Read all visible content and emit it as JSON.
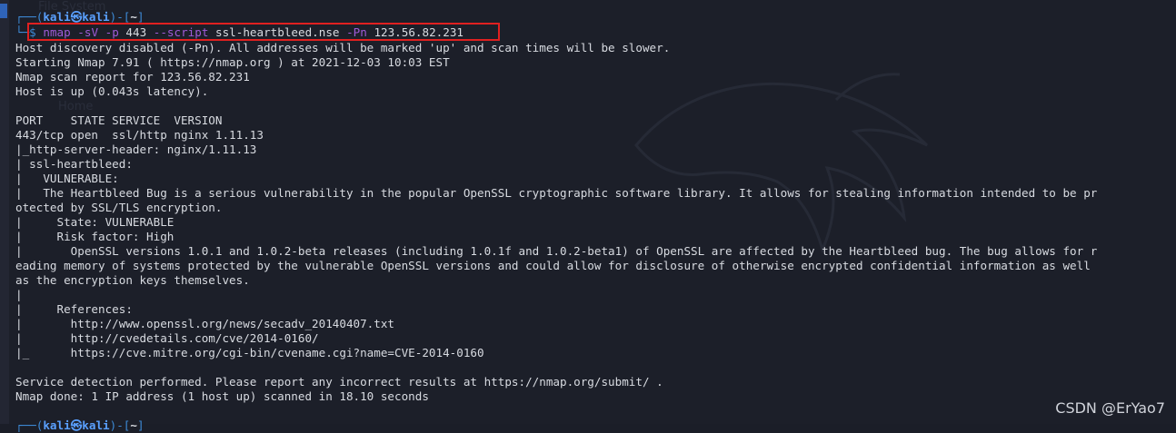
{
  "window": {
    "title": ""
  },
  "ghost": {
    "file_system": "File System",
    "home": "Home"
  },
  "prompt": {
    "user": "kali",
    "at": "㉿",
    "host": "kali",
    "path": "~",
    "dollar": "$"
  },
  "command": {
    "nmap": "nmap",
    "flag_sv": "-sV",
    "flag_p": "-p",
    "port": "443",
    "flag_script": "--script",
    "script": "ssl-heartbleed.nse",
    "flag_pn": "-Pn",
    "ip": "123.56.82.231"
  },
  "output": {
    "lines": [
      "Host discovery disabled (-Pn). All addresses will be marked 'up' and scan times will be slower.",
      "Starting Nmap 7.91 ( https://nmap.org ) at 2021-12-03 10:03 EST",
      "Nmap scan report for 123.56.82.231",
      "Host is up (0.043s latency).",
      "",
      "PORT    STATE SERVICE  VERSION",
      "443/tcp open  ssl/http nginx 1.11.13",
      "|_http-server-header: nginx/1.11.13",
      "| ssl-heartbleed:",
      "|   VULNERABLE:",
      "|   The Heartbleed Bug is a serious vulnerability in the popular OpenSSL cryptographic software library. It allows for stealing information intended to be pr",
      "otected by SSL/TLS encryption.",
      "|     State: VULNERABLE",
      "|     Risk factor: High",
      "|       OpenSSL versions 1.0.1 and 1.0.2-beta releases (including 1.0.1f and 1.0.2-beta1) of OpenSSL are affected by the Heartbleed bug. The bug allows for r",
      "eading memory of systems protected by the vulnerable OpenSSL versions and could allow for disclosure of otherwise encrypted confidential information as well",
      "as the encryption keys themselves.",
      "|",
      "|     References:",
      "|       http://www.openssl.org/news/secadv_20140407.txt",
      "|       http://cvedetails.com/cve/2014-0160/",
      "|_      https://cve.mitre.org/cgi-bin/cvename.cgi?name=CVE-2014-0160",
      "",
      "Service detection performed. Please report any incorrect results at https://nmap.org/submit/ .",
      "Nmap done: 1 IP address (1 host up) scanned in 18.10 seconds"
    ]
  },
  "watermark": "CSDN @ErYao7",
  "colors": {
    "background": "#1c1f29",
    "prompt_blue": "#3d8ad6",
    "command_purple": "#9f5bd8",
    "highlight_red": "#e02020",
    "text": "#d8dbe1"
  }
}
